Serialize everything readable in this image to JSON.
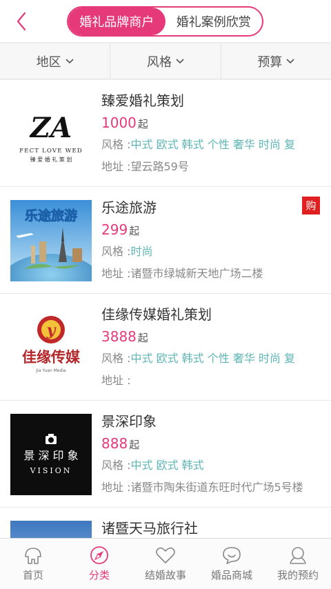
{
  "header": {
    "tabs": [
      {
        "label": "婚礼品牌商户",
        "active": true
      },
      {
        "label": "婚礼案例欣赏",
        "active": false
      }
    ],
    "accent": "#e6397a"
  },
  "filters": [
    {
      "label": "地区"
    },
    {
      "label": "风格"
    },
    {
      "label": "预算"
    }
  ],
  "style_prefix": "风格 :",
  "addr_prefix": "地址 :",
  "merchants": [
    {
      "name": "臻爱婚礼策划",
      "price": "1000",
      "unit": "起",
      "styles": "中式 欧式 韩式 个性 奢华 时尚 复",
      "address": "望云路59号",
      "logo": {
        "main": "ZA",
        "line1": "FECT LOVE WED",
        "line2": "臻 爱 婚 礼 策 划"
      }
    },
    {
      "name": "乐途旅游",
      "price": "299",
      "unit": "起",
      "styles": "时尚",
      "address": "诸暨市绿城新天地广场二楼",
      "badge": "购",
      "logo": {
        "main": "乐途旅游"
      }
    },
    {
      "name": "佳缘传媒婚礼策划",
      "price": "3888",
      "unit": "起",
      "styles": "中式 欧式 韩式 个性 奢华 时尚 复",
      "address": "",
      "logo": {
        "main": "佳缘传媒",
        "sub": "Jia Yuan Media",
        "mark": "y"
      }
    },
    {
      "name": "景深印象",
      "price": "888",
      "unit": "起",
      "styles": "中式 欧式 韩式",
      "address": "诸暨市陶朱街道东旺时代广场5号楼",
      "logo": {
        "main": "景 深 印 象",
        "sub": "VISION"
      }
    },
    {
      "name": "诸暨天马旅行社",
      "price": "",
      "unit": "",
      "styles": "",
      "address": ""
    }
  ],
  "tabbar": [
    {
      "label": "首页",
      "icon": "home-icon",
      "active": false
    },
    {
      "label": "分类",
      "icon": "compass-icon",
      "active": true
    },
    {
      "label": "结婚故事",
      "icon": "heart-icon",
      "active": false
    },
    {
      "label": "婚品商城",
      "icon": "smile-bubble-icon",
      "active": false
    },
    {
      "label": "我的预约",
      "icon": "user-icon",
      "active": false
    }
  ]
}
